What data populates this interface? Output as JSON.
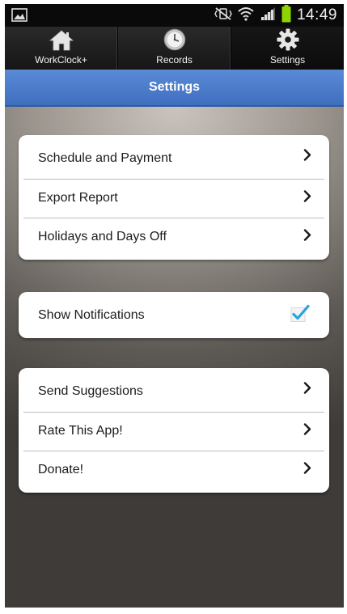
{
  "status_bar": {
    "time": "14:49",
    "icons": [
      "gallery-notification-icon",
      "mute-vibrate-icon",
      "wifi-icon",
      "signal-icon",
      "battery-icon"
    ]
  },
  "tabs": [
    {
      "label": "WorkClock+",
      "icon": "home-icon",
      "active": false
    },
    {
      "label": "Records",
      "icon": "clock-icon",
      "active": false
    },
    {
      "label": "Settings",
      "icon": "gear-icon",
      "active": true
    }
  ],
  "header": {
    "title": "Settings",
    "color": "#4a7bcc"
  },
  "groups": [
    {
      "items": [
        {
          "label": "Schedule and Payment",
          "icon": "chevron-right-icon"
        },
        {
          "label": "Export Report",
          "icon": "chevron-right-icon"
        },
        {
          "label": "Holidays and Days Off",
          "icon": "chevron-right-icon"
        }
      ]
    },
    {
      "items": [
        {
          "label": "Show Notifications",
          "icon": "checkmark-icon",
          "checked": true
        }
      ]
    },
    {
      "items": [
        {
          "label": "Send Suggestions",
          "icon": "chevron-right-icon"
        },
        {
          "label": "Rate This App!",
          "icon": "chevron-right-icon"
        },
        {
          "label": "Donate!",
          "icon": "chevron-right-icon"
        }
      ]
    }
  ]
}
